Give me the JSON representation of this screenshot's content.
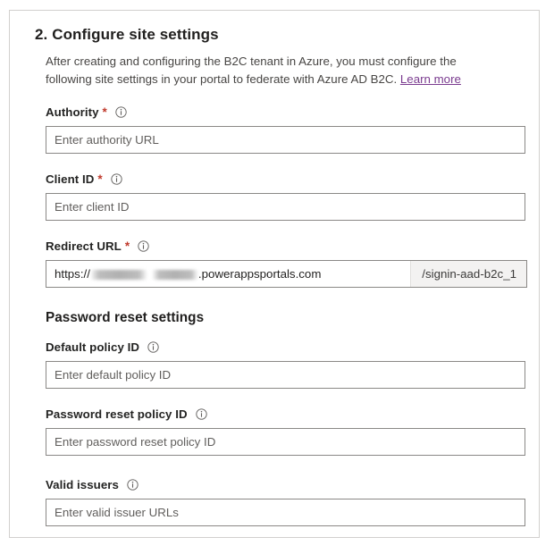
{
  "card": {
    "section_number_title": "2. Configure site settings",
    "description_part1": "After creating and configuring the B2C tenant in Azure, you must configure the following site settings in your portal to federate with Azure AD B2C. ",
    "learn_more_label": "Learn more"
  },
  "colors": {
    "card_border": "#d2d0ce",
    "title_text": "#201f1e",
    "body_text": "#484644",
    "link": "#7a3b8f",
    "required_asterisk": "#c0392b",
    "input_border": "#8a8886",
    "placeholder": "#605e5c",
    "suffix_background": "#f3f2f1"
  },
  "icons": {
    "info": "info-icon"
  },
  "fields": {
    "authority": {
      "label": "Authority",
      "required_marker": "*",
      "placeholder": "Enter authority URL",
      "value": ""
    },
    "client_id": {
      "label": "Client ID",
      "required_marker": "*",
      "placeholder": "Enter client ID",
      "value": ""
    },
    "redirect_url": {
      "label": "Redirect URL",
      "required_marker": "*",
      "value_prefix": "https://",
      "value_domain_suffix": ".powerappsportals.com",
      "value_redacted": true,
      "suffix": "/signin-aad-b2c_1"
    },
    "default_policy_id": {
      "label": "Default policy ID",
      "placeholder": "Enter default policy ID",
      "value": ""
    },
    "password_reset_policy_id": {
      "label": "Password reset policy ID",
      "placeholder": "Enter password reset policy ID",
      "value": ""
    },
    "valid_issuers": {
      "label": "Valid issuers",
      "placeholder": "Enter valid issuer URLs",
      "value": ""
    }
  },
  "password_reset_section": {
    "heading": "Password reset settings"
  }
}
